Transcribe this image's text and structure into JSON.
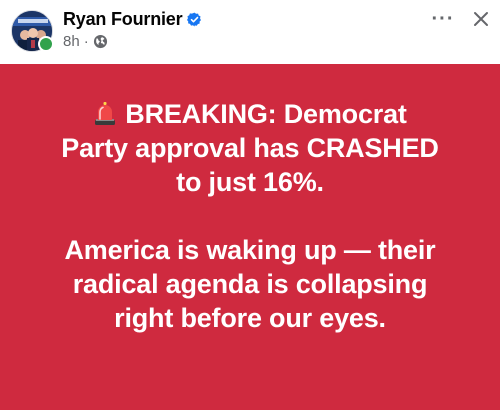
{
  "header": {
    "author_name": "Ryan Fournier",
    "time_ago": "8h",
    "separator": "·",
    "audience_icon": "globe-icon",
    "verified_icon": "verified-badge-icon",
    "more_label": "···",
    "close_icon": "close-icon"
  },
  "post": {
    "background_color": "#cf2a3f",
    "text_color": "#ffffff",
    "emoji_icon": "rotating-light-icon",
    "line1": "BREAKING: Democrat",
    "line2": "Party approval has CRASHED",
    "line3": "to just 16%.",
    "line4": "America is waking up — their",
    "line5": "radical agenda is collapsing",
    "line6": "right before our eyes."
  },
  "colors": {
    "verified_blue": "#1877f2",
    "online_green": "#31a24c",
    "meta_gray": "#65676b"
  }
}
